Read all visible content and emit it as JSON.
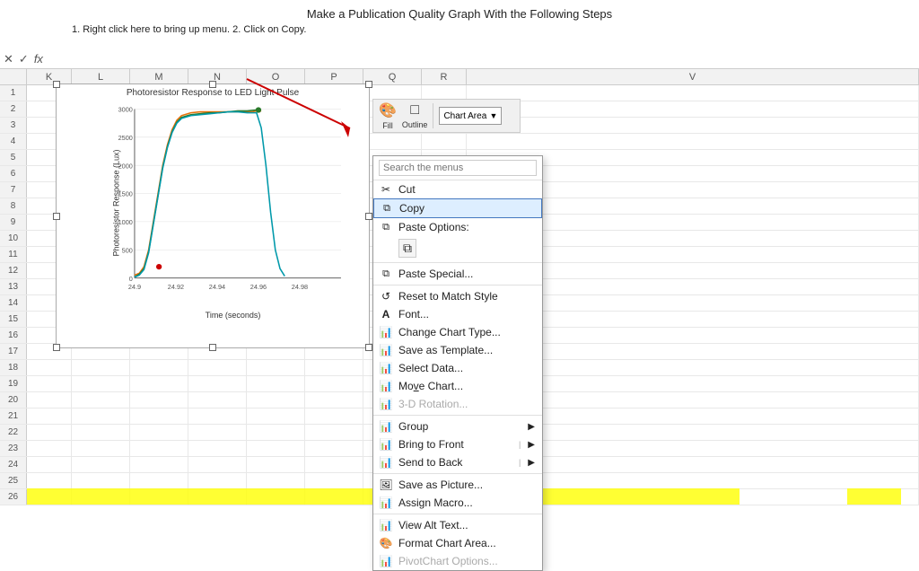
{
  "title": "Make a Publication Quality Graph With the Following Steps",
  "subtitle": "1. Right click here to bring up menu.  2. Click on Copy.",
  "formula_bar": {
    "icons": [
      "✕",
      "✓"
    ],
    "fx": "fx"
  },
  "columns": [
    "K",
    "L",
    "M",
    "N",
    "O",
    "P",
    "Q",
    "R",
    "V"
  ],
  "chart": {
    "title": "Photoresistor Response to LED Light Pulse",
    "y_label": "Photoresistor Response (Lux)",
    "x_label": "Time (seconds)",
    "y_ticks": [
      "3000",
      "2500",
      "2000",
      "1500",
      "1000",
      "500",
      "0"
    ],
    "x_ticks": [
      "24.9",
      "24.92",
      "24.94",
      "24.96",
      "24.98"
    ]
  },
  "ribbon": {
    "fill_label": "Fill",
    "outline_label": "Outline",
    "dropdown_label": "Chart Area"
  },
  "context_menu": {
    "search_placeholder": "Search the menus",
    "items": [
      {
        "id": "cut",
        "label": "Cut",
        "icon": "✂",
        "disabled": false
      },
      {
        "id": "copy",
        "label": "Copy",
        "icon": "📋",
        "disabled": false,
        "highlighted": true
      },
      {
        "id": "paste-options",
        "label": "Paste Options:",
        "icon": "📋",
        "disabled": false,
        "is_header": true
      },
      {
        "id": "paste-icon",
        "label": "",
        "icon": "📋",
        "disabled": false,
        "is_paste_icon": true
      },
      {
        "id": "paste-special",
        "label": "Paste Special...",
        "icon": "📋",
        "disabled": false
      },
      {
        "id": "reset-style",
        "label": "Reset to Match Style",
        "icon": "↺",
        "disabled": false
      },
      {
        "id": "font",
        "label": "Font...",
        "icon": "A",
        "disabled": false
      },
      {
        "id": "change-chart-type",
        "label": "Change Chart Type...",
        "icon": "📊",
        "disabled": false
      },
      {
        "id": "save-as-template",
        "label": "Save as Template...",
        "icon": "📊",
        "disabled": false
      },
      {
        "id": "select-data",
        "label": "Select Data...",
        "icon": "📊",
        "disabled": false
      },
      {
        "id": "move-chart",
        "label": "Move Chart...",
        "icon": "📊",
        "disabled": false
      },
      {
        "id": "3d-rotation",
        "label": "3-D Rotation...",
        "icon": "📊",
        "disabled": true
      },
      {
        "id": "group",
        "label": "Group",
        "icon": "📊",
        "disabled": false,
        "has_arrow": true
      },
      {
        "id": "bring-to-front",
        "label": "Bring to Front",
        "icon": "📊",
        "disabled": false,
        "has_arrow": true
      },
      {
        "id": "send-to-back",
        "label": "Send to Back",
        "icon": "📊",
        "disabled": false,
        "has_arrow": true
      },
      {
        "id": "save-as-picture",
        "label": "Save as Picture...",
        "icon": "🖼",
        "disabled": false
      },
      {
        "id": "assign-macro",
        "label": "Assign Macro...",
        "icon": "📊",
        "disabled": false
      },
      {
        "id": "view-alt-text",
        "label": "View Alt Text...",
        "icon": "📊",
        "disabled": false
      },
      {
        "id": "format-chart-area",
        "label": "Format Chart Area...",
        "icon": "📊",
        "disabled": false
      },
      {
        "id": "pivotchart-options",
        "label": "PivotChart Options...",
        "icon": "📊",
        "disabled": true
      }
    ]
  }
}
